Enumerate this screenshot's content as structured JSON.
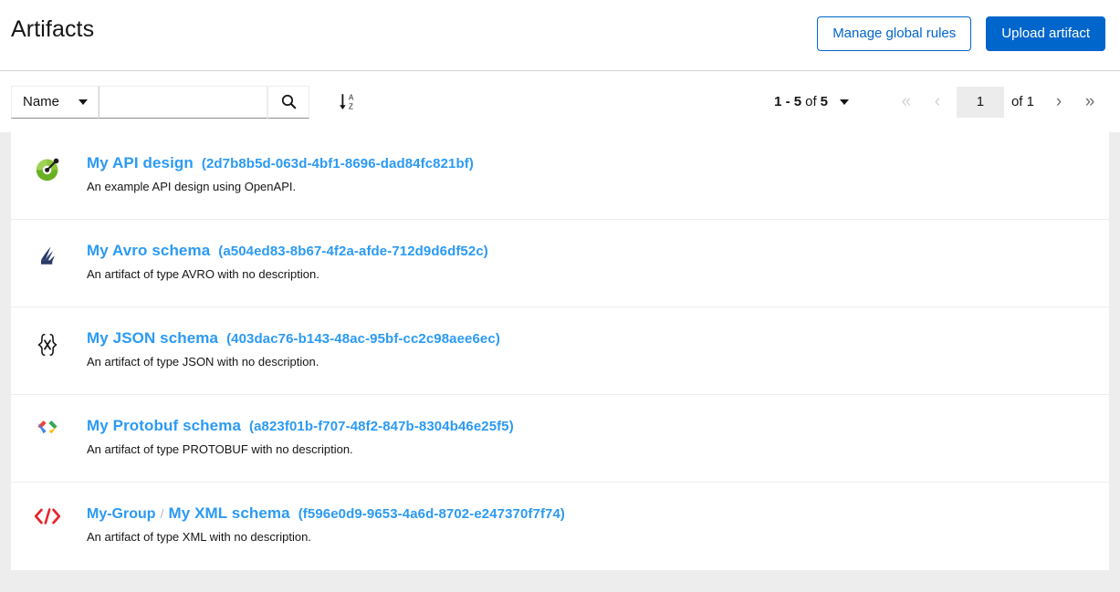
{
  "header": {
    "title": "Artifacts",
    "manage_rules_label": "Manage global rules",
    "upload_label": "Upload artifact"
  },
  "toolbar": {
    "filter_type": "Name",
    "search_value": "",
    "search_placeholder": "",
    "search_icon": "search-icon",
    "sort_icon": "sort-alpha-down-icon"
  },
  "pagination": {
    "range": "1 - 5",
    "of_label": "of",
    "total": "5",
    "first_icon": "«",
    "prev_icon": "‹",
    "next_icon": "›",
    "last_icon": "»",
    "page_value": "1",
    "page_total_label": "of 1"
  },
  "artifacts": [
    {
      "icon": "openapi-icon",
      "group": "",
      "name": "My API design",
      "id": "(2d7b8b5d-063d-4bf1-8696-dad84fc821bf)",
      "description": "An example API design using OpenAPI."
    },
    {
      "icon": "avro-icon",
      "group": "",
      "name": "My Avro schema",
      "id": "(a504ed83-8b67-4f2a-afde-712d9d6df52c)",
      "description": "An artifact of type AVRO with no description."
    },
    {
      "icon": "json-icon",
      "group": "",
      "name": "My JSON schema",
      "id": "(403dac76-b143-48ac-95bf-cc2c98aee6ec)",
      "description": "An artifact of type JSON with no description."
    },
    {
      "icon": "protobuf-icon",
      "group": "",
      "name": "My Protobuf schema",
      "id": "(a823f01b-f707-48f2-847b-8304b46e25f5)",
      "description": "An artifact of type PROTOBUF with no description."
    },
    {
      "icon": "xml-icon",
      "group": "My-Group",
      "group_separator": "/",
      "name": "My XML schema",
      "id": "(f596e0d9-9653-4a6d-8702-e247370f7f74)",
      "description": "An artifact of type XML with no description."
    }
  ],
  "colors": {
    "accent": "#0066cc",
    "link": "#2b9af3",
    "background": "#ededed",
    "xml_red": "#e8262a",
    "avro_navy": "#2b3a67"
  }
}
